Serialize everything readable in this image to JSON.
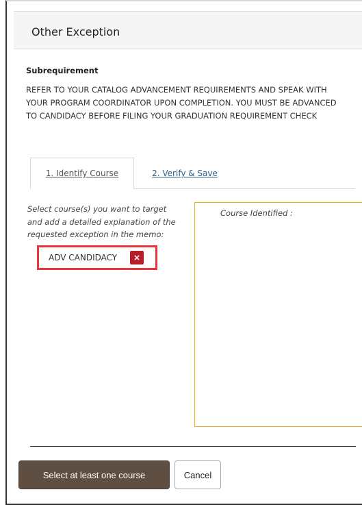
{
  "dialog": {
    "title": "Other Exception"
  },
  "subrequirement": {
    "label": "Subrequirement",
    "text": "REFER TO YOUR CATALOG ADVANCEMENT REQUIREMENTS AND SPEAK WITH YOUR PROGRAM COORDINATOR UPON COMPLETION. YOU MUST BE ADVANCED TO CANDIDACY BEFORE FILING YOUR GRADUATION REQUIREMENT CHECK"
  },
  "tabs": [
    {
      "label": "1. Identify Course",
      "active": true
    },
    {
      "label": "2. Verify & Save",
      "active": false
    }
  ],
  "instruction": "Select course(s) you want to target and add a detailed explanation of the requested exception in the memo:",
  "selected_course": {
    "label": "ADV CANDIDACY",
    "remove_icon": "close-icon"
  },
  "course_identified": {
    "title": "Course Identified :"
  },
  "actions": {
    "primary_label": "Select at least one course",
    "cancel_label": "Cancel"
  },
  "colors": {
    "primary_button": "#5f4f43",
    "highlight_border": "#e8343a",
    "remove_button": "#b51f2b",
    "identified_border": "#f0ad1f",
    "link": "#2a5d88"
  }
}
